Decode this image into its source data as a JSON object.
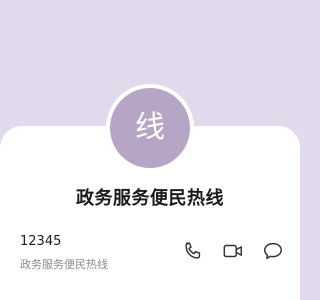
{
  "contact": {
    "avatar_letter": "线",
    "name": "政务服务便民热线"
  },
  "phone": {
    "number": "12345",
    "label": "政务服务便民热线"
  },
  "actions": {
    "call_icon": "phone-icon",
    "video_icon": "video-camera-icon",
    "message_icon": "chat-bubble-icon"
  },
  "colors": {
    "header_background": "#e3d9ec",
    "avatar_background": "#b6a5c5",
    "card_background": "#ffffff",
    "icon_color": "#333333"
  }
}
